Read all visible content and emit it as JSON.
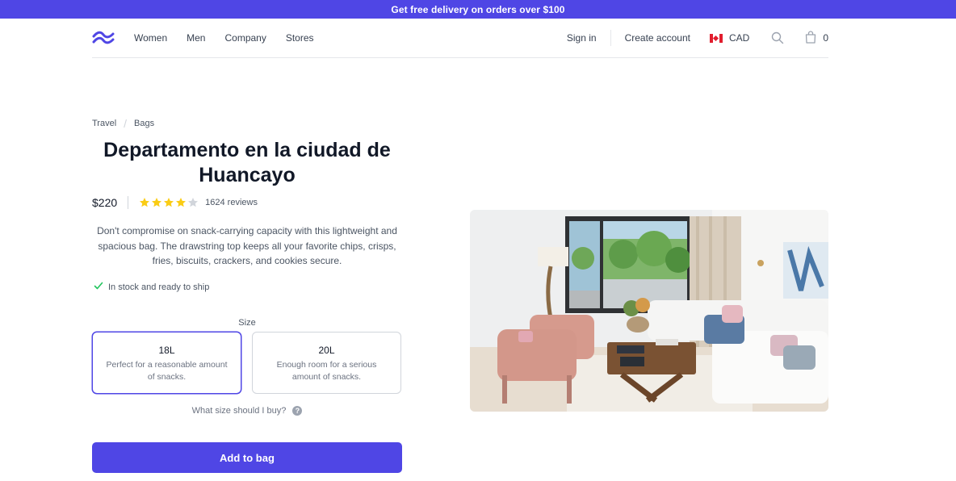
{
  "promo": {
    "text": "Get free delivery on orders over $100"
  },
  "nav": {
    "links": [
      "Women",
      "Men",
      "Company",
      "Stores"
    ],
    "sign_in": "Sign in",
    "create_account": "Create account",
    "currency": "CAD",
    "cart_count": "0"
  },
  "breadcrumb": [
    "Travel",
    "Bags"
  ],
  "product": {
    "title": "Departamento en la ciudad de Huancayo",
    "price": "$220",
    "rating": 4,
    "rating_max": 5,
    "reviews": "1624 reviews",
    "description": "Don't compromise on snack-carrying capacity with this lightweight and spacious bag. The drawstring top keeps all your favorite chips, crisps, fries, biscuits, crackers, and cookies secure.",
    "stock": "In stock and ready to ship",
    "size_label": "Size",
    "sizes": [
      {
        "name": "18L",
        "description": "Perfect for a reasonable amount of snacks.",
        "selected": true
      },
      {
        "name": "20L",
        "description": "Enough room for a serious amount of snacks.",
        "selected": false
      }
    ],
    "size_help": "What size should I buy?",
    "add_to_bag": "Add to bag"
  },
  "colors": {
    "accent": "#4f46e5",
    "star": "#facc15",
    "star_empty": "#d1d5db",
    "check": "#22c55e"
  }
}
